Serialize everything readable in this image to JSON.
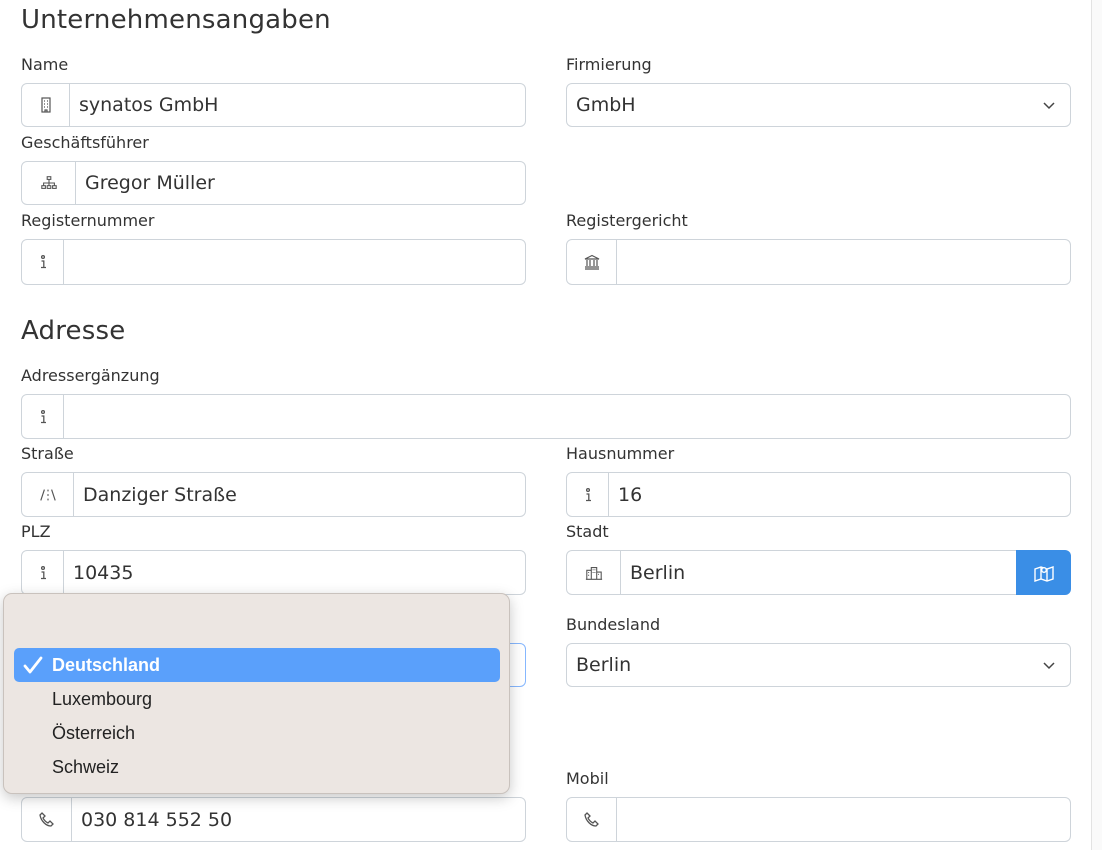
{
  "company": {
    "heading": "Unternehmensangaben",
    "name_label": "Name",
    "name_value": "synatos GmbH",
    "firmierung_label": "Firmierung",
    "firmierung_value": "GmbH",
    "gf_label": "Geschäftsführer",
    "gf_value": "Gregor Müller",
    "regnr_label": "Registernummer",
    "regnr_value": "",
    "regger_label": "Registergericht",
    "regger_value": ""
  },
  "address": {
    "heading": "Adresse",
    "zusatz_label": "Adressergänzung",
    "zusatz_value": "",
    "street_label": "Straße",
    "street_value": "Danziger Straße",
    "house_label": "Hausnummer",
    "house_value": "16",
    "plz_label": "PLZ",
    "plz_value": "10435",
    "city_label": "Stadt",
    "city_value": "Berlin",
    "state_label": "Bundesland",
    "state_value": "Berlin"
  },
  "contact": {
    "mobil_label": "Mobil",
    "phone_value": "030 814 552 50",
    "mobil_value": ""
  },
  "country_dropdown": {
    "options": [
      "Deutschland",
      "Luxembourg",
      "Österreich",
      "Schweiz"
    ],
    "selected": "Deutschland"
  },
  "icons": {
    "name": "building-icon",
    "gf": "org-chart-icon",
    "regnr": "info-icon",
    "regger": "bank-icon",
    "zusatz": "info-icon",
    "street": "road-icon",
    "house": "info-icon",
    "plz": "info-icon",
    "city": "city-icon",
    "map": "map-icon",
    "phone": "phone-icon"
  },
  "colors": {
    "accent": "#3a8ee6",
    "dropdown_bg": "#ece6e2",
    "dropdown_selected": "#5aa0fb"
  }
}
